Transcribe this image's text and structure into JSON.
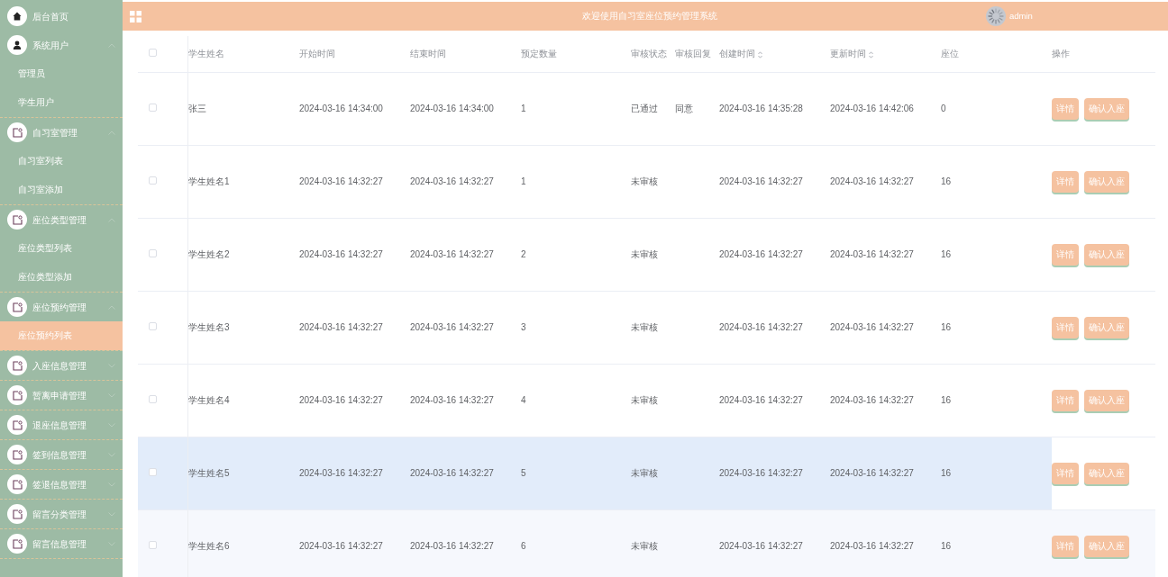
{
  "sidebar": {
    "items": [
      {
        "label": "后台首页",
        "kind": "home"
      },
      {
        "label": "系统用户",
        "kind": "users",
        "expanded": true,
        "children": [
          {
            "label": "管理员",
            "selected": false
          },
          {
            "label": "学生用户",
            "selected": false
          }
        ]
      },
      {
        "label": "自习室管理",
        "kind": "module",
        "expanded": true,
        "children": [
          {
            "label": "自习室列表",
            "selected": false
          },
          {
            "label": "自习室添加",
            "selected": false
          }
        ]
      },
      {
        "label": "座位类型管理",
        "kind": "module",
        "expanded": true,
        "children": [
          {
            "label": "座位类型列表",
            "selected": false
          },
          {
            "label": "座位类型添加",
            "selected": false
          }
        ]
      },
      {
        "label": "座位预约管理",
        "kind": "module",
        "expanded": true,
        "children": [
          {
            "label": "座位预约列表",
            "selected": true
          }
        ]
      },
      {
        "label": "入座信息管理",
        "kind": "module",
        "expanded": false
      },
      {
        "label": "暂离申请管理",
        "kind": "module",
        "expanded": false
      },
      {
        "label": "退座信息管理",
        "kind": "module",
        "expanded": false
      },
      {
        "label": "签到信息管理",
        "kind": "module",
        "expanded": false
      },
      {
        "label": "签退信息管理",
        "kind": "module",
        "expanded": false
      },
      {
        "label": "留言分类管理",
        "kind": "module",
        "expanded": false
      },
      {
        "label": "留言信息管理",
        "kind": "module",
        "expanded": false
      }
    ]
  },
  "header": {
    "title": "欢迎使用自习室座位预约管理系统",
    "user": "admin"
  },
  "table": {
    "select_all": {
      "checked": false
    },
    "columns": [
      {
        "label": "学生姓名",
        "sortable": false
      },
      {
        "label": "开始时间",
        "sortable": false
      },
      {
        "label": "结束时间",
        "sortable": false
      },
      {
        "label": "预定数量",
        "sortable": false
      },
      {
        "label": "审核状态",
        "sortable": false
      },
      {
        "label": "审核回复",
        "sortable": false
      },
      {
        "label": "创建时间",
        "sortable": true
      },
      {
        "label": "更新时间",
        "sortable": true
      },
      {
        "label": "座位",
        "sortable": false
      },
      {
        "label": "操作",
        "sortable": false
      }
    ],
    "rows": [
      {
        "checked": false,
        "hovered": false,
        "cells": [
          "张三",
          "2024-03-16 14:34:00",
          "2024-03-16 14:34:00",
          "1",
          "已通过",
          "同意",
          "2024-03-16 14:35:28",
          "2024-03-16 14:42:06",
          "0"
        ],
        "actions": [
          "详情",
          "确认入座"
        ]
      },
      {
        "checked": false,
        "hovered": false,
        "cells": [
          "学生姓名1",
          "2024-03-16 14:32:27",
          "2024-03-16 14:32:27",
          "1",
          "未审核",
          "",
          "2024-03-16 14:32:27",
          "2024-03-16 14:32:27",
          "16"
        ],
        "actions": [
          "详情",
          "确认入座"
        ]
      },
      {
        "checked": false,
        "hovered": false,
        "cells": [
          "学生姓名2",
          "2024-03-16 14:32:27",
          "2024-03-16 14:32:27",
          "2",
          "未审核",
          "",
          "2024-03-16 14:32:27",
          "2024-03-16 14:32:27",
          "16"
        ],
        "actions": [
          "详情",
          "确认入座"
        ]
      },
      {
        "checked": false,
        "hovered": false,
        "cells": [
          "学生姓名3",
          "2024-03-16 14:32:27",
          "2024-03-16 14:32:27",
          "3",
          "未审核",
          "",
          "2024-03-16 14:32:27",
          "2024-03-16 14:32:27",
          "16"
        ],
        "actions": [
          "详情",
          "确认入座"
        ]
      },
      {
        "checked": false,
        "hovered": false,
        "cells": [
          "学生姓名4",
          "2024-03-16 14:32:27",
          "2024-03-16 14:32:27",
          "4",
          "未审核",
          "",
          "2024-03-16 14:32:27",
          "2024-03-16 14:32:27",
          "16"
        ],
        "actions": [
          "详情",
          "确认入座"
        ]
      },
      {
        "checked": false,
        "hovered": true,
        "cells": [
          "学生姓名5",
          "2024-03-16 14:32:27",
          "2024-03-16 14:32:27",
          "5",
          "未审核",
          "",
          "2024-03-16 14:32:27",
          "2024-03-16 14:32:27",
          "16"
        ],
        "actions": [
          "详情",
          "确认入座"
        ]
      },
      {
        "checked": false,
        "hovered": false,
        "cells": [
          "学生姓名6",
          "2024-03-16 14:32:27",
          "2024-03-16 14:32:27",
          "6",
          "未审核",
          "",
          "2024-03-16 14:32:27",
          "2024-03-16 14:32:27",
          "16"
        ],
        "actions": [
          "详情",
          "确认入座"
        ]
      }
    ]
  }
}
